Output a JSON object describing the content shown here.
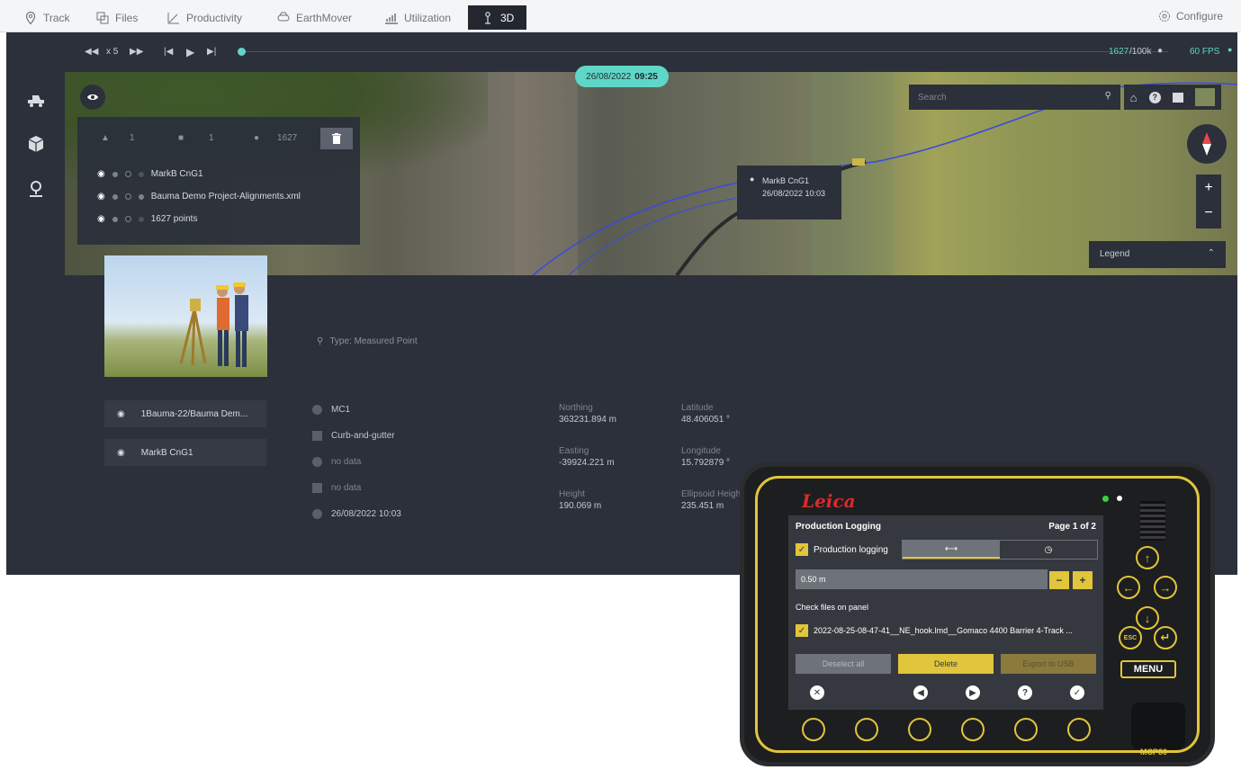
{
  "nav": {
    "tabs": [
      {
        "label": "Track",
        "icon": "pin-icon"
      },
      {
        "label": "Files",
        "icon": "files-icon"
      },
      {
        "label": "Productivity",
        "icon": "productivity-icon"
      },
      {
        "label": "EarthMover",
        "icon": "earthmover-icon"
      },
      {
        "label": "Utilization",
        "icon": "utilization-icon"
      },
      {
        "label": "3D",
        "icon": "3d-icon",
        "active": true
      }
    ],
    "configure": "Configure"
  },
  "player": {
    "speed": "x 5",
    "points": "1627",
    "points_max": "/100k",
    "fps": "60 FPS"
  },
  "map": {
    "date": "26/08/2022",
    "time": "09:25",
    "search_placeholder": "Search",
    "legend": "Legend",
    "zoom_in": "+",
    "zoom_out": "−",
    "tooltip": {
      "name": "MarkB CnG1",
      "datetime": "26/08/2022 10:03"
    }
  },
  "layers": {
    "stats": [
      "1",
      "1",
      "1627"
    ],
    "rows": [
      "MarkB CnG1",
      "Bauma Demo Project-Alignments.xml",
      "1627 points"
    ]
  },
  "detail": {
    "type": "Type: Measured Point",
    "files": [
      "1Bauma-22/Bauma Dem...",
      "MarkB CnG1"
    ],
    "attrs": [
      "MC1",
      "Curb-and-gutter",
      "no data",
      "no data",
      "26/08/2022 10:03"
    ],
    "coords": [
      {
        "k": "Northing",
        "v": "363231.894 m"
      },
      {
        "k": "Latitude",
        "v": "48.406051 °"
      },
      {
        "k": "Easting",
        "v": "-39924.221 m"
      },
      {
        "k": "Longitude",
        "v": "15.792879 °"
      },
      {
        "k": "Height",
        "v": "190.069 m"
      },
      {
        "k": "Ellipsoid Height",
        "v": "235.451 m"
      }
    ]
  },
  "device": {
    "brand": "Leica",
    "model": "MCP80",
    "title": "Production Logging",
    "page": "Page 1 of 2",
    "logging_label": "Production logging",
    "interval_value": "0.50 m",
    "minus": "−",
    "plus": "+",
    "check_files": "Check files on panel",
    "file": "2022-08-25-08-47-41__NE_hook.lmd__Gomaco 4400 Barrier 4-Track ...",
    "btn_deselect": "Deselect all",
    "btn_delete": "Delete",
    "btn_export": "Export to USB",
    "menu": "MENU",
    "esc": "ESC",
    "accent": "#e1c53a"
  }
}
